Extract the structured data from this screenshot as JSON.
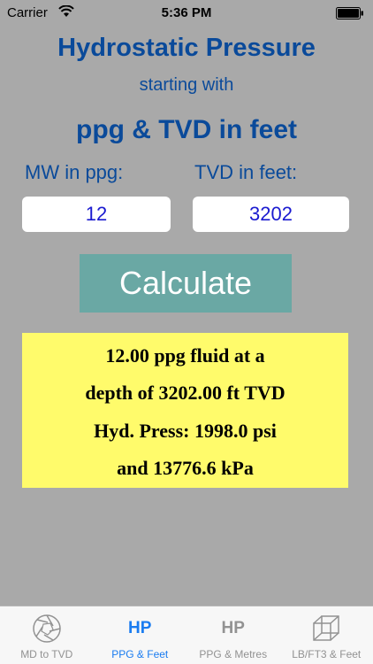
{
  "status_bar": {
    "carrier": "Carrier",
    "time": "5:36 PM"
  },
  "header": {
    "title": "Hydrostatic Pressure",
    "subtitle": "starting with",
    "units_title": "ppg & TVD in feet"
  },
  "form": {
    "mw_label": "MW in ppg:",
    "mw_value": "12",
    "tvd_label": "TVD in feet:",
    "tvd_value": "3202",
    "calculate_label": "Calculate"
  },
  "result": {
    "line1": "12.00 ppg fluid at a",
    "line2": "depth of 3202.00 ft TVD",
    "line3": "Hyd. Press: 1998.0 psi",
    "line4": "and 13776.6 kPa"
  },
  "tabs": [
    {
      "label": "MD to TVD",
      "icon": "aperture-icon",
      "active": false
    },
    {
      "label": "PPG & Feet",
      "icon_text": "HP",
      "active": true
    },
    {
      "label": "PPG & Metres",
      "icon_text": "HP",
      "active": false
    },
    {
      "label": "LB/FT3 & Feet",
      "icon": "cube-icon",
      "active": false
    }
  ],
  "colors": {
    "background": "#a9a9a9",
    "title": "#0a4a9a",
    "input_text": "#1a1ad0",
    "button": "#6aa8a4",
    "result_box": "#fffb6b",
    "tab_active": "#1a7cf0",
    "tab_inactive": "#929292"
  }
}
